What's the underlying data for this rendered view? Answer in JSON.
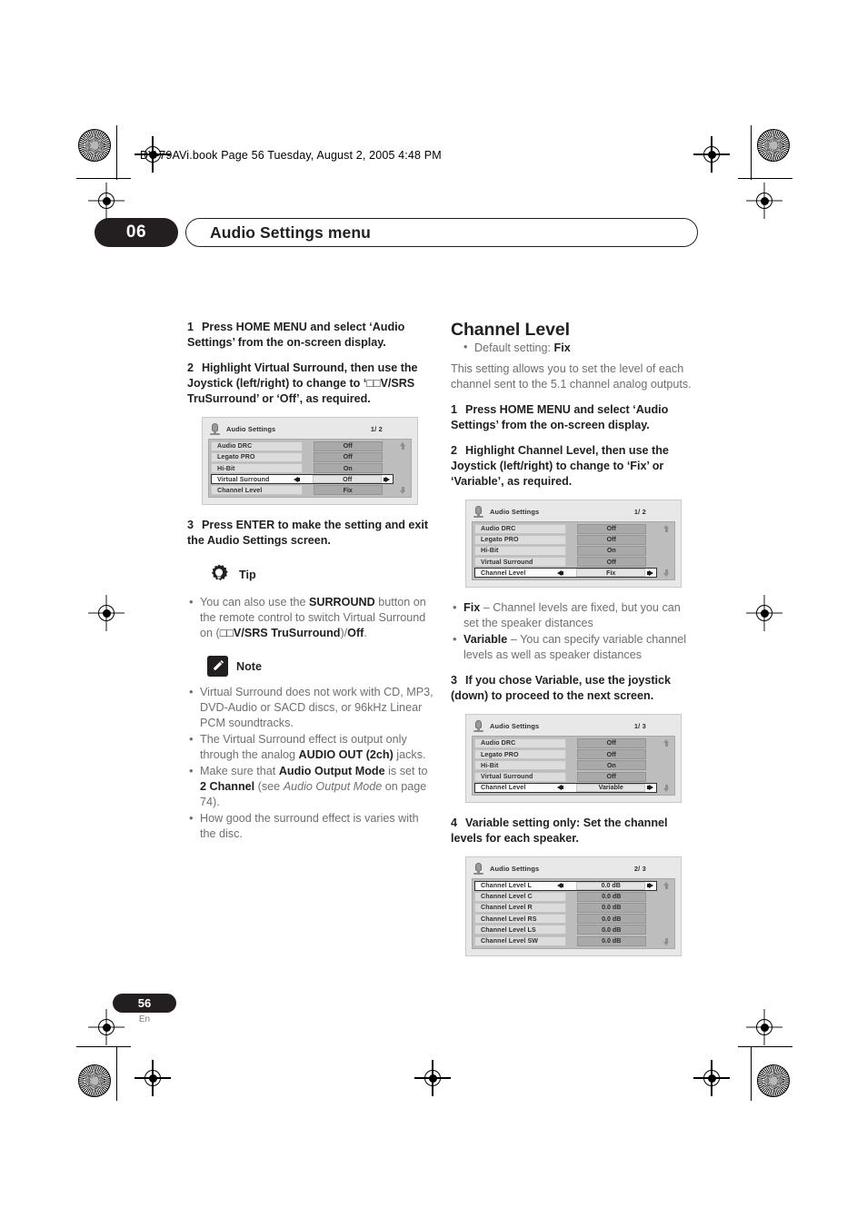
{
  "document": {
    "filepath_line": "DV-79AVi.book  Page 56  Tuesday, August 2, 2005  4:48 PM",
    "chapter_number": "06",
    "chapter_title": "Audio Settings menu",
    "page_number": "56",
    "language_code": "En"
  },
  "left_column": {
    "step1": {
      "num": "1",
      "text": "Press HOME MENU and select ‘Audio Settings’ from the on-screen display."
    },
    "step2": {
      "num": "2",
      "text": "Highlight Virtual Surround, then use the Joystick (left/right) to change to ‘□□V/SRS TruSurround’ or ‘Off’, as required."
    },
    "step3": {
      "num": "3",
      "text": "Press ENTER to make the setting and exit the Audio Settings screen."
    },
    "tip": {
      "label": "Tip",
      "icon": "gear-lightbulb-icon",
      "bullets": [
        "You can also use the SURROUND button on the remote control to switch Virtual Surround on (□□V/SRS TruSurround)/Off."
      ]
    },
    "note": {
      "label": "Note",
      "icon": "pencil-icon",
      "bullets": [
        "Virtual Surround does not work with CD, MP3, DVD-Audio or SACD discs, or 96kHz Linear PCM soundtracks.",
        "The Virtual Surround effect is output only through the analog AUDIO OUT (2ch) jacks.",
        "Make sure that Audio Output Mode is set to 2 Channel (see Audio Output Mode on page 74).",
        "How good the surround effect is varies with the disc."
      ]
    }
  },
  "right_column": {
    "section_title": "Channel Level",
    "default_setting_label": "Default setting:",
    "default_setting_value": "Fix",
    "intro": "This setting allows you to set the level of each channel sent to the 5.1 channel analog outputs.",
    "step1": {
      "num": "1",
      "text": "Press HOME MENU and select ‘Audio Settings’ from the on-screen display."
    },
    "step2": {
      "num": "2",
      "text": "Highlight Channel Level, then use the Joystick (left/right) to change to ‘Fix’ or ‘Variable’, as required."
    },
    "options": [
      {
        "term": "Fix",
        "dash": "–",
        "desc": "Channel levels are fixed, but you can set the speaker distances"
      },
      {
        "term": "Variable",
        "dash": "–",
        "desc": "You can specify variable channel levels as well as speaker distances"
      }
    ],
    "step3": {
      "num": "3",
      "text": "If you chose Variable, use the joystick (down) to proceed to the next screen."
    },
    "step4": {
      "num": "4",
      "text": "Variable setting only: Set the channel levels for each speaker."
    }
  },
  "osd_screens": [
    {
      "id": "osd-virtual-surround",
      "title": "Audio Settings",
      "page_indicator": "1/ 2",
      "rows": [
        {
          "label": "Audio DRC",
          "value": "Off",
          "selected": false
        },
        {
          "label": "Legato PRO",
          "value": "Off",
          "selected": false
        },
        {
          "label": "Hi-Bit",
          "value": "On",
          "selected": false
        },
        {
          "label": "Virtual Surround",
          "value": "Off",
          "selected": true
        },
        {
          "label": "Channel Level",
          "value": "Fix",
          "selected": false
        }
      ]
    },
    {
      "id": "osd-channel-level-fix",
      "title": "Audio Settings",
      "page_indicator": "1/ 2",
      "rows": [
        {
          "label": "Audio DRC",
          "value": "Off",
          "selected": false
        },
        {
          "label": "Legato PRO",
          "value": "Off",
          "selected": false
        },
        {
          "label": "Hi-Bit",
          "value": "On",
          "selected": false
        },
        {
          "label": "Virtual Surround",
          "value": "Off",
          "selected": false
        },
        {
          "label": "Channel Level",
          "value": "Fix",
          "selected": true
        }
      ]
    },
    {
      "id": "osd-channel-level-variable",
      "title": "Audio Settings",
      "page_indicator": "1/ 3",
      "rows": [
        {
          "label": "Audio DRC",
          "value": "Off",
          "selected": false
        },
        {
          "label": "Legato PRO",
          "value": "Off",
          "selected": false
        },
        {
          "label": "Hi-Bit",
          "value": "On",
          "selected": false
        },
        {
          "label": "Virtual Surround",
          "value": "Off",
          "selected": false
        },
        {
          "label": "Channel Level",
          "value": "Variable",
          "selected": true
        }
      ]
    },
    {
      "id": "osd-channel-levels",
      "title": "Audio Settings",
      "page_indicator": "2/ 3",
      "rows": [
        {
          "label": "Channel Level L",
          "value": "0.0 dB",
          "selected": true
        },
        {
          "label": "Channel Level C",
          "value": "0.0 dB",
          "selected": false
        },
        {
          "label": "Channel Level R",
          "value": "0.0 dB",
          "selected": false
        },
        {
          "label": "Channel Level RS",
          "value": "0.0 dB",
          "selected": false
        },
        {
          "label": "Channel Level LS",
          "value": "0.0 dB",
          "selected": false
        },
        {
          "label": "Channel Level SW",
          "value": "0.0 dB",
          "selected": false
        }
      ]
    }
  ],
  "colors": {
    "ink": "#231f20",
    "body_grey": "#6f6f6f",
    "osd_panel": "#bdbdbd",
    "osd_label": "#dcdcdc",
    "osd_value": "#a9a9a9"
  }
}
